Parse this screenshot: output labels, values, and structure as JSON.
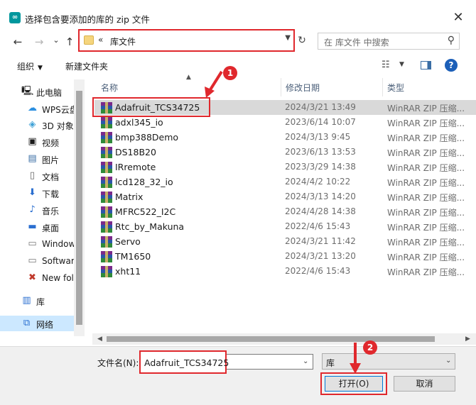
{
  "window": {
    "title": "选择包含要添加的库的 zip 文件",
    "close_glyph": "✕"
  },
  "nav": {
    "back_glyph": "←",
    "forward_glyph": "→",
    "dropdown_glyph": "⌄",
    "up_glyph": "↑",
    "address_sep": "«",
    "address": "库文件",
    "search_placeholder": "在 库文件 中搜索"
  },
  "toolbar": {
    "organize": "组织",
    "new_folder": "新建文件夹"
  },
  "sidebar": {
    "items": [
      {
        "label": "此电脑",
        "icon": "computer-icon"
      },
      {
        "label": "WPS云盘",
        "icon": "cloud-icon"
      },
      {
        "label": "3D 对象",
        "icon": "cube-icon"
      },
      {
        "label": "视频",
        "icon": "video-icon"
      },
      {
        "label": "图片",
        "icon": "picture-icon"
      },
      {
        "label": "文档",
        "icon": "document-icon"
      },
      {
        "label": "下载",
        "icon": "download-icon"
      },
      {
        "label": "音乐",
        "icon": "music-icon"
      },
      {
        "label": "桌面",
        "icon": "desktop-icon"
      },
      {
        "label": "Window",
        "icon": "drive-icon"
      },
      {
        "label": "Softwar",
        "icon": "drive-icon"
      },
      {
        "label": "New fol",
        "icon": "drive-icon"
      },
      {
        "label": "库",
        "icon": "library-icon"
      },
      {
        "label": "网络",
        "icon": "network-icon"
      }
    ]
  },
  "columns": {
    "name": "名称",
    "date": "修改日期",
    "type": "类型"
  },
  "files": [
    {
      "name": "Adafruit_TCS34725",
      "date": "2024/3/21 13:49",
      "type": "WinRAR ZIP 压缩..."
    },
    {
      "name": "adxl345_io",
      "date": "2023/6/14 10:07",
      "type": "WinRAR ZIP 压缩..."
    },
    {
      "name": "bmp388Demo",
      "date": "2024/3/13 9:45",
      "type": "WinRAR ZIP 压缩..."
    },
    {
      "name": "DS18B20",
      "date": "2023/6/13 13:53",
      "type": "WinRAR ZIP 压缩..."
    },
    {
      "name": "IRremote",
      "date": "2023/3/29 14:38",
      "type": "WinRAR ZIP 压缩..."
    },
    {
      "name": "lcd128_32_io",
      "date": "2024/4/2 10:22",
      "type": "WinRAR ZIP 压缩..."
    },
    {
      "name": "Matrix",
      "date": "2024/3/13 14:20",
      "type": "WinRAR ZIP 压缩..."
    },
    {
      "name": "MFRC522_I2C",
      "date": "2024/4/28 14:38",
      "type": "WinRAR ZIP 压缩..."
    },
    {
      "name": "Rtc_by_Makuna",
      "date": "2022/4/6 15:43",
      "type": "WinRAR ZIP 压缩..."
    },
    {
      "name": "Servo",
      "date": "2024/3/21 11:42",
      "type": "WinRAR ZIP 压缩..."
    },
    {
      "name": "TM1650",
      "date": "2024/3/21 13:20",
      "type": "WinRAR ZIP 压缩..."
    },
    {
      "name": "xht11",
      "date": "2022/4/6 15:43",
      "type": "WinRAR ZIP 压缩..."
    }
  ],
  "bottom": {
    "filename_label": "文件名(N):",
    "filename_value": "Adafruit_TCS34725",
    "filter_value": "库",
    "open_label": "打开(O)",
    "cancel_label": "取消"
  },
  "annotations": {
    "step1": "1",
    "step2": "2",
    "highlight_color": "#e0282d"
  }
}
